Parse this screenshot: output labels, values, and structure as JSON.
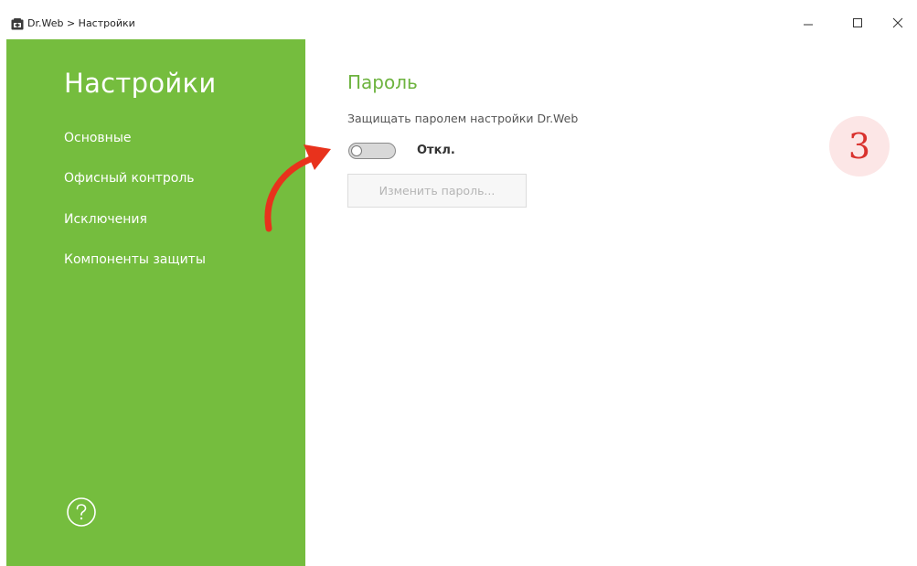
{
  "window": {
    "title": "Dr.Web > Настройки",
    "controls": {
      "minimize_icon": "minimize-icon",
      "maximize_icon": "maximize-icon",
      "close_icon": "close-icon"
    }
  },
  "sidebar": {
    "title": "Настройки",
    "background_color": "#75bd3e",
    "items": [
      {
        "label": "Основные"
      },
      {
        "label": "Офисный контроль"
      },
      {
        "label": "Исключения"
      },
      {
        "label": "Компоненты защиты"
      }
    ],
    "help_icon": "help-circle-icon"
  },
  "main": {
    "section_title": "Пароль",
    "section_title_color": "#6db33f",
    "setting_label": "Защищать паролем настройки Dr.Web",
    "toggle": {
      "state": "off",
      "state_label": "Откл."
    },
    "change_password_button": {
      "label": "Изменить пароль...",
      "enabled": false
    }
  },
  "annotation": {
    "step_number": "3",
    "arrow_color": "#e8321c",
    "badge_text_color": "#d9322e"
  }
}
